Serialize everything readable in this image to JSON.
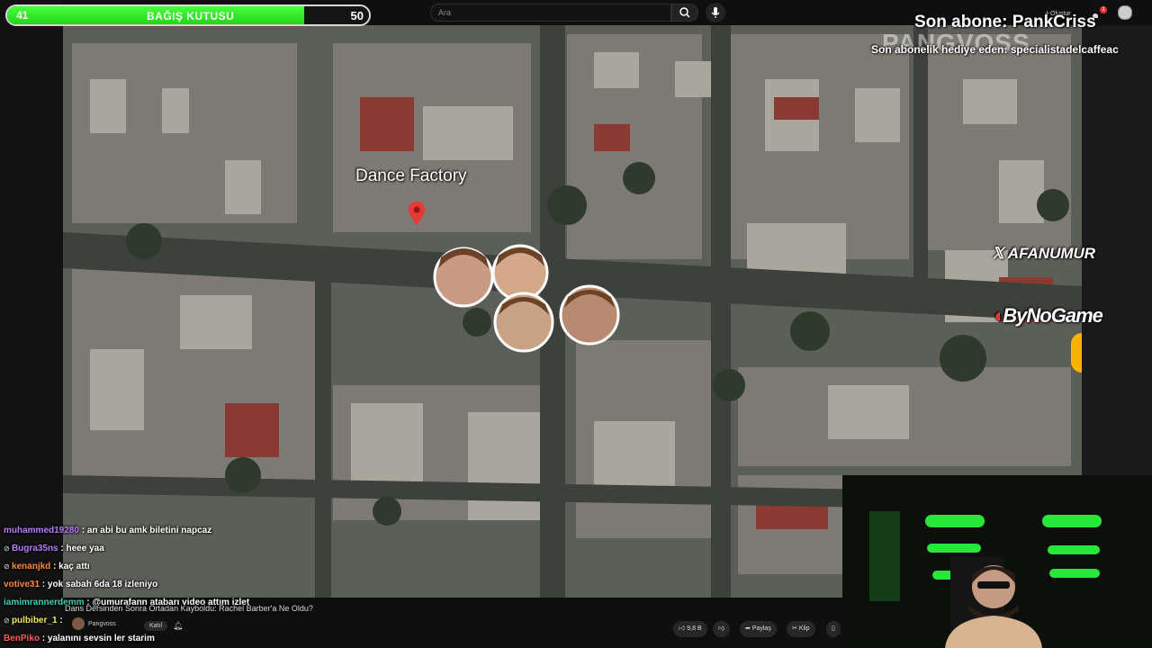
{
  "donation_bar": {
    "current": "41",
    "title": "BAĞIŞ KUTUSU",
    "max": "50",
    "progress": 0.82
  },
  "search": {
    "placeholder": "Ara"
  },
  "header": {
    "create_label": "Oluştur",
    "notification_count": "1"
  },
  "overlay": {
    "last_subscriber": "Son abone: PankCriss",
    "gift_subscriber": "Son abonelik hediye eden: specialistadelcaffeac",
    "watermark": "PANGVOSS",
    "x_handle": "AFANUMUR",
    "sponsor": "ByNoGame"
  },
  "map": {
    "place_label": "Dance Factory",
    "marker_color": "#e53935"
  },
  "chat": [
    {
      "user": "muhammed19280",
      "color": "#b77bff",
      "text": " : an abi bu amk biletini napcaz",
      "badge": false
    },
    {
      "user": "Bugra35ns",
      "color": "#b77bff",
      "text": " : heee yaa",
      "badge": true
    },
    {
      "user": "kenanjkd",
      "color": "#ff8a3d",
      "text": " : kaç attı",
      "badge": true
    },
    {
      "user": "votive31",
      "color": "#ff8a3d",
      "text": " : yok sabah 6da 18 izleniyo",
      "badge": false
    },
    {
      "user": "iamimrannerdemm",
      "color": "#3fd0b8",
      "text": " : @umurafann atabarı video attım izlet",
      "badge": false
    },
    {
      "user": "pulbiber_1",
      "color": "#f2e85a",
      "text": " :",
      "badge": true
    },
    {
      "user": "BenPiko",
      "color": "#ff5a5a",
      "text": " : yalanını sevsin ler starim",
      "badge": false
    }
  ],
  "video": {
    "title": "Dans Dersinden Sonra Ortadan Kayboldu: Rachel Barber'a Ne Oldu?",
    "channel": "Pangvoss",
    "join_label": "Katıl",
    "likes": "9,8 B",
    "share_label": "Paylaş",
    "clip_label": "Klip"
  }
}
